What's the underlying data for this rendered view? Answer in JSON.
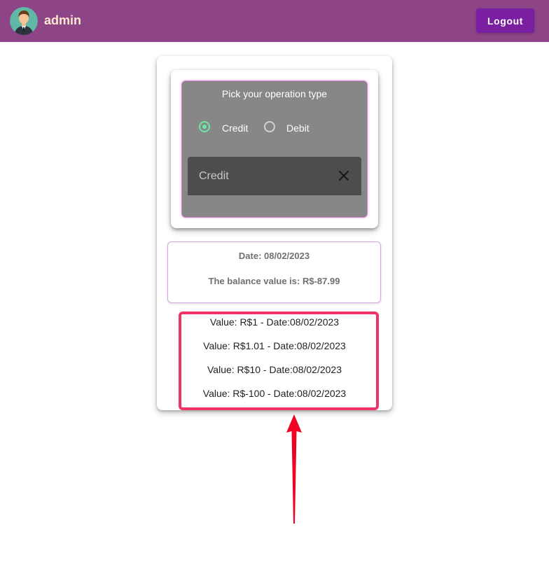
{
  "header": {
    "username": "admin",
    "logout_label": "Logout",
    "avatar_icon": "person-avatar-icon"
  },
  "operation": {
    "title": "Pick your operation type",
    "options": [
      {
        "label": "Credit",
        "checked": true
      },
      {
        "label": "Debit",
        "checked": false
      }
    ],
    "selected_value": "Credit",
    "clear_icon": "close-icon"
  },
  "balance": {
    "date_text": "Date: 08/02/2023",
    "value_text": "The balance value is: R$-87.99"
  },
  "transactions": [
    {
      "text": "Value: R$1 - Date:08/02/2023"
    },
    {
      "text": "Value: R$1.01 - Date:08/02/2023"
    },
    {
      "text": "Value: R$10 - Date:08/02/2023"
    },
    {
      "text": "Value: R$-100 - Date:08/02/2023"
    }
  ],
  "colors": {
    "header_bg": "#8d4588",
    "logout_bg": "#7b1fa2",
    "radio_checked": "#6ee7a7",
    "highlight": "#ee3366",
    "arrow": "#f00022"
  }
}
